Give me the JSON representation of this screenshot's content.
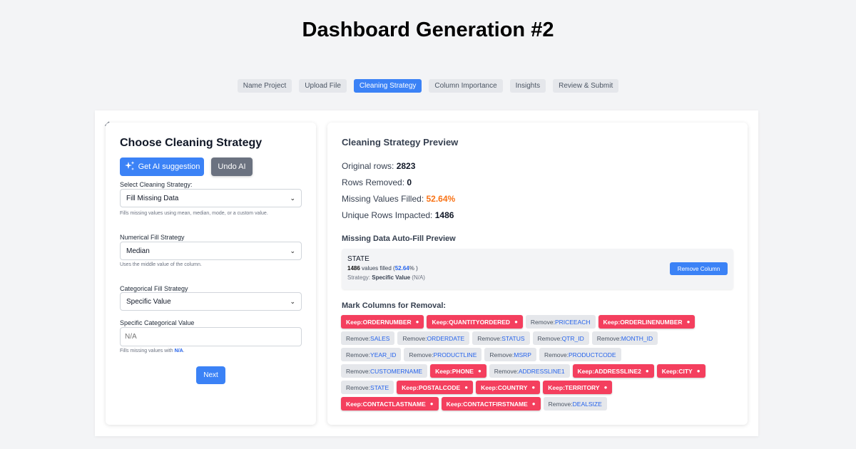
{
  "page": {
    "title": "Dashboard Generation #2"
  },
  "steps": [
    {
      "label": "Name Project",
      "active": false
    },
    {
      "label": "Upload File",
      "active": false
    },
    {
      "label": "Cleaning Strategy",
      "active": true
    },
    {
      "label": "Column Importance",
      "active": false
    },
    {
      "label": "Insights",
      "active": false
    },
    {
      "label": "Review & Submit",
      "active": false
    }
  ],
  "left": {
    "title": "Choose Cleaning Strategy",
    "ai_button": "Get AI suggestion",
    "undo_button": "Undo AI",
    "strategy": {
      "label": "Select Cleaning Strategy:",
      "value": "Fill Missing Data",
      "help": "Fills missing values using mean, median, mode, or a custom value."
    },
    "numerical": {
      "label": "Numerical Fill Strategy",
      "value": "Median",
      "help": "Uses the middle value of the column."
    },
    "categorical": {
      "label": "Categorical Fill Strategy",
      "value": "Specific Value"
    },
    "specific": {
      "label": "Specific Categorical Value",
      "placeholder": "N/A",
      "help_prefix": "Fills missing values with",
      "help_value": "N/A",
      "help_suffix": "."
    },
    "next_button": "Next"
  },
  "right": {
    "title": "Cleaning Strategy Preview",
    "stats": {
      "original_label": "Original rows:",
      "original_value": "2823",
      "removed_label": "Rows Removed:",
      "removed_value": "0",
      "filled_label": "Missing Values Filled:",
      "filled_value": "52.64%",
      "impacted_label": "Unique Rows Impacted:",
      "impacted_value": "1486"
    },
    "autofill": {
      "title": "Missing Data Auto-Fill Preview",
      "column": "STATE",
      "filled_count": "1486",
      "filled_text": "values filled (",
      "filled_pct": "52.64",
      "filled_suffix": "% )",
      "strategy_label": "Strategy:",
      "strategy_value": "Specific Value",
      "strategy_extra": "(N/A)",
      "remove_button": "Remove Column"
    },
    "mark_title": "Mark Columns for Removal:",
    "colors": {
      "keep": "#f43f5e",
      "remove": "#e5e7eb",
      "accent": "#3b82f6"
    },
    "chip_rows": [
      [
        {
          "action": "Keep",
          "column": "ORDERNUMBER"
        },
        {
          "action": "Keep",
          "column": "QUANTITYORDERED"
        },
        {
          "action": "Remove",
          "column": "PRICEEACH"
        },
        {
          "action": "Keep",
          "column": "ORDERLINENUMBER"
        }
      ],
      [
        {
          "action": "Remove",
          "column": "SALES"
        },
        {
          "action": "Remove",
          "column": "ORDERDATE"
        },
        {
          "action": "Remove",
          "column": "STATUS"
        },
        {
          "action": "Remove",
          "column": "QTR_ID"
        },
        {
          "action": "Remove",
          "column": "MONTH_ID"
        }
      ],
      [
        {
          "action": "Remove",
          "column": "YEAR_ID"
        },
        {
          "action": "Remove",
          "column": "PRODUCTLINE"
        },
        {
          "action": "Remove",
          "column": "MSRP"
        },
        {
          "action": "Remove",
          "column": "PRODUCTCODE"
        }
      ],
      [
        {
          "action": "Remove",
          "column": "CUSTOMERNAME"
        },
        {
          "action": "Keep",
          "column": "PHONE"
        },
        {
          "action": "Remove",
          "column": "ADDRESSLINE1"
        },
        {
          "action": "Keep",
          "column": "ADDRESSLINE2"
        },
        {
          "action": "Keep",
          "column": "CITY"
        }
      ],
      [
        {
          "action": "Remove",
          "column": "STATE"
        },
        {
          "action": "Keep",
          "column": "POSTALCODE"
        },
        {
          "action": "Keep",
          "column": "COUNTRY"
        },
        {
          "action": "Keep",
          "column": "TERRITORY"
        }
      ],
      [
        {
          "action": "Keep",
          "column": "CONTACTLASTNAME"
        },
        {
          "action": "Keep",
          "column": "CONTACTFIRSTNAME"
        },
        {
          "action": "Remove",
          "column": "DEALSIZE"
        }
      ]
    ]
  }
}
